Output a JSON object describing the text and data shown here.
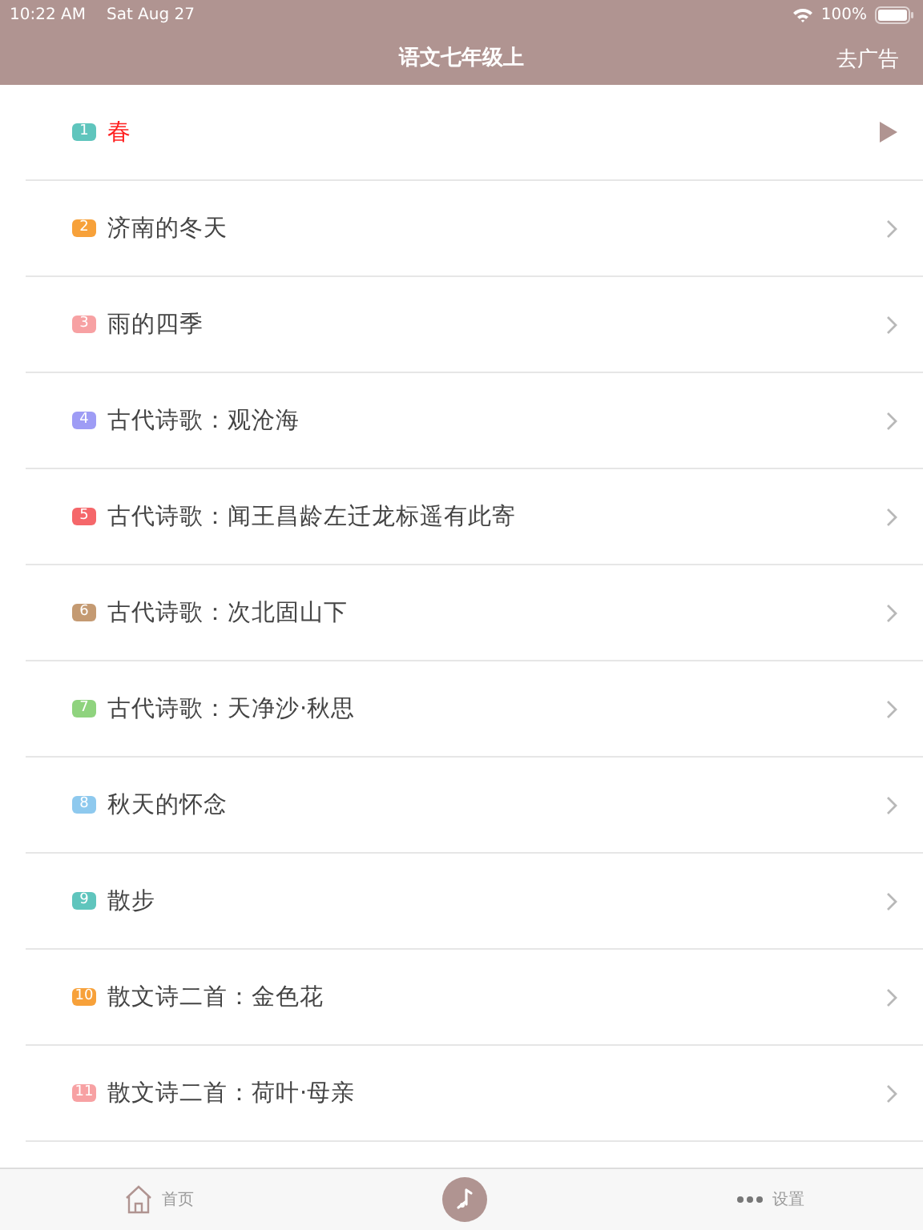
{
  "status_bar": {
    "time": "10:22 AM",
    "date": "Sat Aug 27",
    "battery": "100%"
  },
  "nav": {
    "title": "语文七年级上",
    "action": "去广告"
  },
  "lessons": [
    {
      "number": "1",
      "title": "春",
      "color": "#5fc5bd",
      "selected": true
    },
    {
      "number": "2",
      "title": "济南的冬天",
      "color": "#f7a13a",
      "selected": false
    },
    {
      "number": "3",
      "title": "雨的四季",
      "color": "#f7a1a3",
      "selected": false
    },
    {
      "number": "4",
      "title": "古代诗歌：观沧海",
      "color": "#9e9cf5",
      "selected": false
    },
    {
      "number": "5",
      "title": "古代诗歌：闻王昌龄左迁龙标遥有此寄",
      "color": "#f5676a",
      "selected": false
    },
    {
      "number": "6",
      "title": "古代诗歌：次北固山下",
      "color": "#c49a72",
      "selected": false
    },
    {
      "number": "7",
      "title": "古代诗歌：天净沙·秋思",
      "color": "#8fd37e",
      "selected": false
    },
    {
      "number": "8",
      "title": "秋天的怀念",
      "color": "#8ec9ee",
      "selected": false
    },
    {
      "number": "9",
      "title": "散步",
      "color": "#5fc5bd",
      "selected": false
    },
    {
      "number": "10",
      "title": "散文诗二首：金色花",
      "color": "#f7a13a",
      "selected": false
    },
    {
      "number": "11",
      "title": "散文诗二首：荷叶·母亲",
      "color": "#f7a1a3",
      "selected": false
    }
  ],
  "tab_bar": [
    {
      "label": "首页",
      "kind": "home"
    },
    {
      "kind": "center"
    },
    {
      "label": "设置",
      "kind": "more"
    }
  ]
}
